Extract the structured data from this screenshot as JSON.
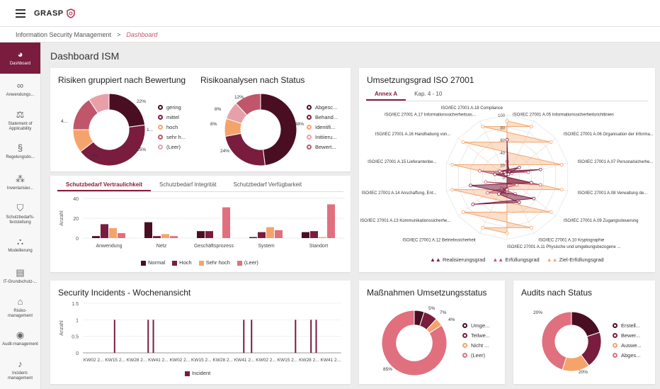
{
  "app": {
    "logo": "GRASP"
  },
  "breadcrumb": {
    "root": "Information Security Management",
    "sep": ">",
    "current": "Dashboard"
  },
  "sidebar": {
    "items": [
      {
        "label": "Dashboard",
        "icon": "pie-chart-icon"
      },
      {
        "label": "Anwendungs...",
        "icon": "glasses-icon"
      },
      {
        "label": "Statement of Applicability",
        "icon": "scales-icon"
      },
      {
        "label": "Regelungsdo...",
        "icon": "paragraph-icon"
      },
      {
        "label": "Inventarisier...",
        "icon": "network-icon"
      },
      {
        "label": "Schutzbedarfs-feststellung",
        "icon": "shield-icon"
      },
      {
        "label": "Modellierung",
        "icon": "hierarchy-icon"
      },
      {
        "label": "IT-Grundschutz-...",
        "icon": "clipboard-icon"
      },
      {
        "label": "Risiko-management",
        "icon": "house-icon"
      },
      {
        "label": "Audit-management",
        "icon": "eye-icon"
      },
      {
        "label": "Incident-management",
        "icon": "bell-icon"
      }
    ]
  },
  "page": {
    "title": "Dashboard ISM"
  },
  "risks": {
    "title": "Risiken gruppiert nach Bewertung",
    "labels": [
      "22%",
      "4...",
      "1...",
      "15%",
      "9%"
    ],
    "legend": [
      "gering",
      "mittel",
      "hoch",
      "sehr h...",
      "(Leer)"
    ]
  },
  "analyses": {
    "title": "Risikoanalysen nach Status",
    "labels": [
      "12%",
      "8%",
      "8%",
      "48%",
      "24%"
    ],
    "legend": [
      "Abgesc...",
      "Behand...",
      "Identifi...",
      "Initiieru...",
      "Bewert..."
    ]
  },
  "protection": {
    "tabs": [
      "Schutzbedarf Vertraulichkeit",
      "Schutzbedarf Integrität",
      "Schutzbedarf Verfügbarkeit"
    ],
    "ylabel": "Anzahl"
  },
  "iso": {
    "title": "Umsetzungsgrad ISO 27001",
    "tabs": [
      "Annex A",
      "Kap. 4 - 10"
    ],
    "axes": [
      "ISO/IEC 27001 A.18 Compliance",
      "ISO/IEC 27001 A.05 Informationssicherheitsrichtlinien",
      "ISO/IEC 27001 A.17 Informationssicherheitsas...",
      "ISO/IEC 27001 A.06 Organisation der Informa...",
      "ISO/IEC 27001 A.16 Handhabung von...",
      "ISO/IEC 27001 A.07 Personalsicherhe...",
      "ISO/IEC 27001 A.15 Lieferantenbe...",
      "ISO/IEC 27001 A.08 Verwaltung de...",
      "ISO/IEC 27001 A.14 Anschaffung, Ent...",
      "ISO/IEC 27001 A.09 Zugangssteuerung",
      "ISO/IEC 27001 A.13 Kommunikationssicherhe...",
      "ISO/IEC 27001 A.10 Kryptographie",
      "ISO/IEC 27001 A.12 Betriebssicherheit",
      "ISO/IEC 27001 A.11 Physische und umgebungsbezogene ..."
    ],
    "ticks": [
      "100",
      "80",
      "60",
      "40",
      "20",
      "0"
    ],
    "legend": [
      "Realisierungsgrad",
      "Erfüllungsgrad",
      "Ziel-Erfüllungsgrad"
    ],
    "colors": [
      "#7a1c3e",
      "#c0566a",
      "#f4a46a"
    ]
  },
  "incidents": {
    "title": "Security Incidents - Wochenansicht",
    "ylabel": "Anzahl",
    "legend": "Incident"
  },
  "measures": {
    "title": "Maßnahmen Umsetzungsstatus",
    "labels": [
      "5%",
      "7%",
      "4%",
      "85%"
    ],
    "legend": [
      "Umge...",
      "Teilwe...",
      "Nicht ...",
      "(Leer)"
    ]
  },
  "audits": {
    "title": "Audits nach Status",
    "labels": [
      "20%",
      "20%"
    ],
    "legend": [
      "Erstell...",
      "Bewer...",
      "Auswe...",
      "Abges..."
    ]
  },
  "chart_data": [
    {
      "type": "pie",
      "title": "Risiken gruppiert nach Bewertung",
      "categories": [
        "gering",
        "mittel",
        "hoch",
        "sehr hoch",
        "(Leer)"
      ],
      "values": [
        22,
        40,
        10,
        15,
        9
      ],
      "colors": [
        "#4a0e22",
        "#7a1c3e",
        "#f4a46a",
        "#c0566a",
        "#e8a0a8"
      ]
    },
    {
      "type": "pie",
      "title": "Risikoanalysen nach Status",
      "categories": [
        "Abgeschlossen",
        "Behandlung",
        "Identifikation",
        "Initiierung",
        "Bewertung"
      ],
      "values": [
        48,
        24,
        8,
        8,
        12
      ],
      "colors": [
        "#4a0e22",
        "#7a1c3e",
        "#f4a46a",
        "#e8a0a8",
        "#c0566a"
      ]
    },
    {
      "type": "bar",
      "categories": [
        "Anwendung",
        "Netz",
        "Geschäftsprozess",
        "System",
        "Standort"
      ],
      "ylim": [
        0,
        40
      ],
      "ylabel": "Anzahl",
      "series": [
        {
          "name": "Normal",
          "values": [
            2,
            16,
            7,
            1,
            6
          ],
          "color": "#4a0e22"
        },
        {
          "name": "Hoch",
          "values": [
            14,
            2,
            7,
            6,
            7
          ],
          "color": "#7a1c3e"
        },
        {
          "name": "Sehr hoch",
          "values": [
            10,
            4,
            0,
            11,
            1
          ],
          "color": "#f4a46a"
        },
        {
          "name": "(Leer)",
          "values": [
            5,
            2,
            31,
            8,
            34
          ],
          "color": "#e0707e"
        }
      ]
    },
    {
      "type": "radar",
      "title": "Umsetzungsgrad ISO 27001",
      "rmax": 100,
      "series": [
        {
          "name": "Realisierungsgrad",
          "values": [
            60,
            5,
            5,
            25,
            15,
            55,
            20,
            40,
            60,
            55,
            70,
            45,
            30,
            20
          ]
        },
        {
          "name": "Erfüllungsgrad",
          "values": [
            25,
            10,
            8,
            10,
            12,
            35,
            45,
            55,
            35,
            20,
            40,
            30,
            20,
            25
          ]
        },
        {
          "name": "Ziel-Erfüllungsgrad",
          "values": [
            90,
            90,
            90,
            90,
            90,
            90,
            90,
            90,
            90,
            90,
            90,
            90,
            90,
            90
          ]
        }
      ]
    },
    {
      "type": "bar",
      "title": "Security Incidents - Wochenansicht",
      "ylim": [
        0,
        1.5
      ],
      "ylabel": "Anzahl",
      "categories": [
        "KW02 2...",
        "KW15 2...",
        "KW28 2...",
        "KW41 2...",
        "KW02 2...",
        "KW15 2...",
        "KW28 2...",
        "KW41 2...",
        "KW02 2...",
        "KW15 2...",
        "KW28 2...",
        "KW41 2..."
      ],
      "series": [
        {
          "name": "Incident",
          "values": [
            1,
            1,
            1,
            1,
            1,
            1,
            1,
            1
          ],
          "positions": [
            0.12,
            0.25,
            0.27,
            0.62,
            0.65,
            0.82,
            0.88,
            0.9
          ]
        }
      ]
    },
    {
      "type": "pie",
      "title": "Maßnahmen Umsetzungsstatus",
      "categories": [
        "Umgesetzt",
        "Teilweise",
        "Nicht umgesetzt",
        "(Leer)"
      ],
      "values": [
        5,
        7,
        4,
        85
      ],
      "colors": [
        "#4a0e22",
        "#7a1c3e",
        "#f4a46a",
        "#e0707e"
      ]
    },
    {
      "type": "pie",
      "title": "Audits nach Status",
      "categories": [
        "Erstellt",
        "Bewertet",
        "Ausgewertet",
        "Abgeschlossen"
      ],
      "values": [
        20,
        20,
        15,
        45
      ],
      "colors": [
        "#4a0e22",
        "#7a1c3e",
        "#f4a46a",
        "#e0707e"
      ]
    }
  ]
}
